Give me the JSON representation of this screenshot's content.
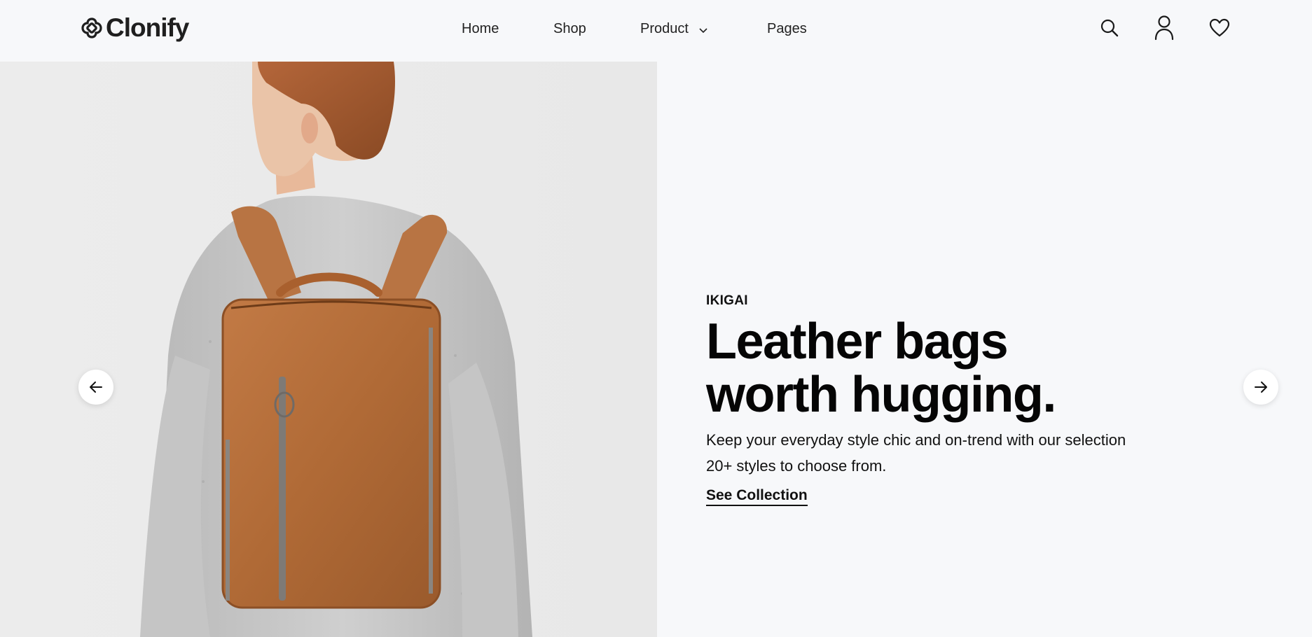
{
  "header": {
    "logo_text": "Clonify",
    "nav": [
      {
        "label": "Home"
      },
      {
        "label": "Shop"
      },
      {
        "label": "Product",
        "has_dropdown": true
      },
      {
        "label": "Pages"
      }
    ],
    "icons": [
      "search-icon",
      "user-icon",
      "heart-icon"
    ]
  },
  "hero": {
    "image_alt": "",
    "eyebrow": "IKIGAI",
    "headline_line1": "Leather bags",
    "headline_line2": "worth hugging.",
    "subtext": "Keep your everyday style chic and on-trend with our selection 20+ styles to choose from.",
    "cta_label": "See Collection"
  },
  "carousel": {
    "prev_icon": "arrow-left-icon",
    "next_icon": "arrow-right-icon"
  },
  "colors": {
    "background": "#f7f8fa",
    "text": "#111111",
    "leather": "#b5703e"
  }
}
